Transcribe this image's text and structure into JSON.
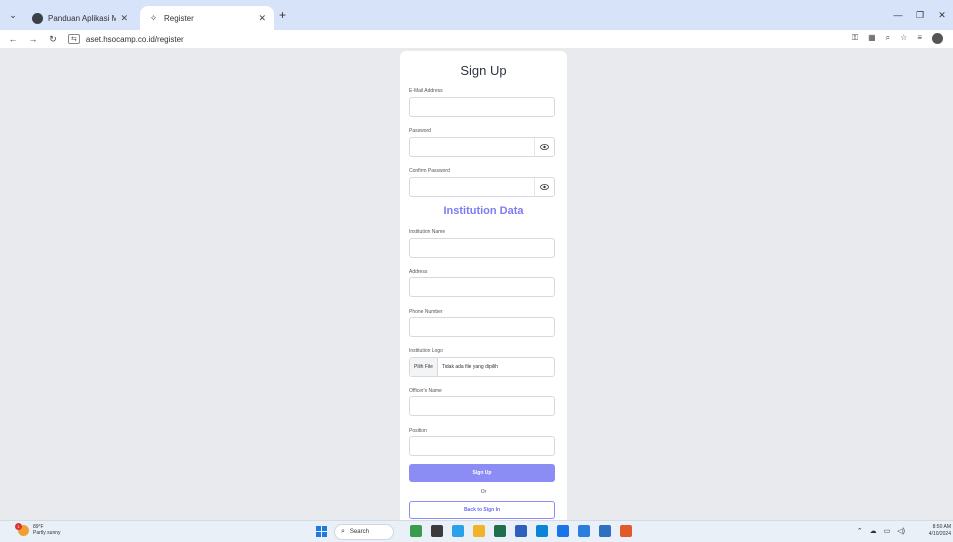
{
  "browser": {
    "tabs": [
      {
        "title": "Panduan Aplikasi Manajemen A",
        "active": false
      },
      {
        "title": "Register",
        "active": true
      }
    ],
    "new_tab": "+",
    "url": "aset.hsocamp.co.id/register"
  },
  "form": {
    "title": "Sign Up",
    "email_label": "E-Mail Address",
    "password_label": "Password",
    "confirm_password_label": "Confirm Password",
    "section_title": "Institution Data",
    "institution_name_label": "Institution Name",
    "address_label": "Address",
    "phone_label": "Phone Number",
    "logo_label": "Institution Logo",
    "file_button": "Pilih File",
    "file_status": "Tidak ada file yang dipilih",
    "officer_label": "Officer's Name",
    "position_label": "Position",
    "submit": "Sign Up",
    "or": "Or",
    "back": "Back to Sign In"
  },
  "taskbar": {
    "weather_temp": "89°F",
    "weather_desc": "Partly sunny",
    "search_placeholder": "Search",
    "time": "8:50 AM",
    "date": "4/10/2024",
    "weather_badge": "1"
  },
  "colors": {
    "accent": "#8c8cf5",
    "heading_accent": "#7d7cf3"
  }
}
